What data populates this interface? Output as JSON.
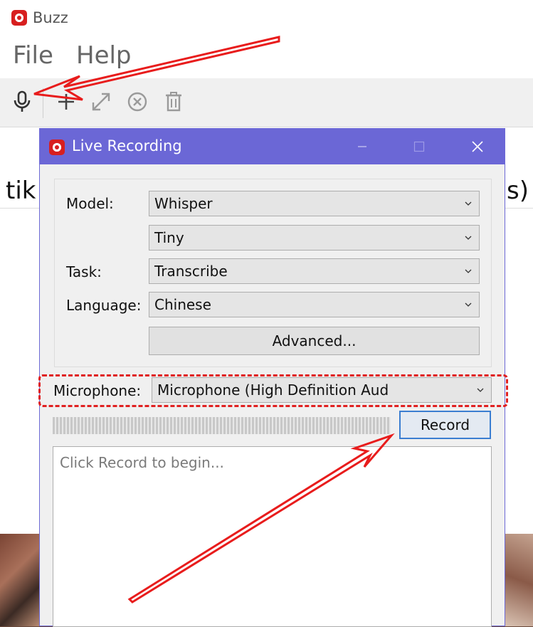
{
  "main_window": {
    "title": "Buzz",
    "menu": [
      "File",
      "Help"
    ],
    "toolbar": {
      "record_icon": "microphone-icon",
      "new_icon": "plus-icon",
      "expand_icon": "expand-icon",
      "cancel_icon": "cancel-circle-icon",
      "delete_icon": "trash-icon"
    },
    "background_text_left": "tik",
    "background_text_right": "s)"
  },
  "dialog": {
    "title": "Live Recording",
    "model_label": "Model:",
    "model_value": "Whisper",
    "model_size_value": "Tiny",
    "task_label": "Task:",
    "task_value": "Transcribe",
    "language_label": "Language:",
    "language_value": "Chinese",
    "advanced_label": "Advanced...",
    "microphone_label": "Microphone:",
    "microphone_value": "Microphone (High Definition Aud",
    "record_label": "Record",
    "transcript_placeholder": "Click Record to begin..."
  },
  "colors": {
    "titlebar": "#6b67d6",
    "annotation": "#e02020",
    "record_border": "#3b7ed1",
    "app_icon": "#d71f1f"
  }
}
